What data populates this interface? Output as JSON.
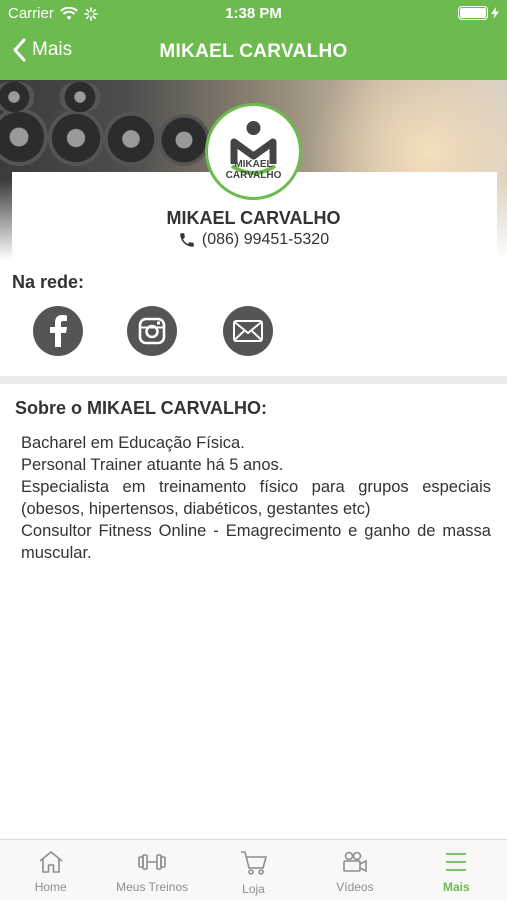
{
  "status_bar": {
    "carrier": "Carrier",
    "time": "1:38 PM"
  },
  "nav": {
    "back_label": "Mais",
    "title": "MIKAEL CARVALHO"
  },
  "profile": {
    "logo_text": "MIKAEL CARVALHO",
    "name": "MIKAEL CARVALHO",
    "phone": "(086) 99451-5320"
  },
  "social": {
    "title": "Na rede:",
    "buttons": [
      "facebook-icon",
      "instagram-icon",
      "mail-icon"
    ]
  },
  "about": {
    "title": "Sobre o MIKAEL CARVALHO:",
    "lines": [
      "Bacharel em Educação Física.",
      "Personal Trainer atuante há 5 anos.",
      "Especialista em treinamento físico para grupos especiais (obesos, hipertensos, diabéticos, gestantes etc)",
      "Consultor Fitness Online - Emagrecimento e ganho de massa muscular."
    ]
  },
  "tabs": [
    {
      "label": "Home",
      "icon": "home-icon"
    },
    {
      "label": "Meus Treinos",
      "icon": "dumbbell-icon"
    },
    {
      "label": "Loja",
      "icon": "cart-icon"
    },
    {
      "label": "Vídeos",
      "icon": "video-camera-icon"
    },
    {
      "label": "Mais",
      "icon": "menu-icon",
      "active": true
    }
  ],
  "colors": {
    "brand_green": "#6dbb4f",
    "icon_gray": "#555555"
  }
}
